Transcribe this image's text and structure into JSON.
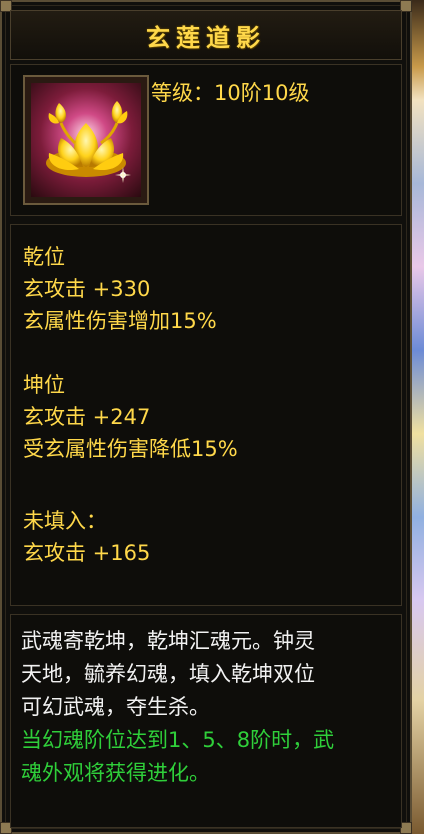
{
  "item": {
    "name": "玄莲道影",
    "level_label": "等级：",
    "level_value": "10阶10级"
  },
  "attributes": {
    "qian": {
      "title": "乾位",
      "lines": [
        "玄攻击 +330",
        "玄属性伤害增加15%"
      ]
    },
    "kun": {
      "title": "坤位",
      "lines": [
        "玄攻击 +247",
        "受玄属性伤害降低15%"
      ]
    },
    "unfilled": {
      "title": "未填入：",
      "lines": [
        "玄攻击 +165"
      ]
    }
  },
  "description": {
    "lore_lines": [
      "武魂寄乾坤，乾坤汇魂元。钟灵",
      "天地，毓养幻魂，填入乾坤双位",
      "可幻武魂，夺生杀。"
    ],
    "evolution_lines": [
      "当幻魂阶位达到1、5、8阶时，武",
      "魂外观将获得进化。"
    ]
  },
  "colors": {
    "gold_text": "#ffd84a",
    "white_text": "#f2f2f2",
    "green_text": "#2fcf3a",
    "panel_bg": "#100f0c",
    "border": "#5a4d35"
  },
  "icons": {
    "item_icon": "golden-lotus-icon"
  }
}
